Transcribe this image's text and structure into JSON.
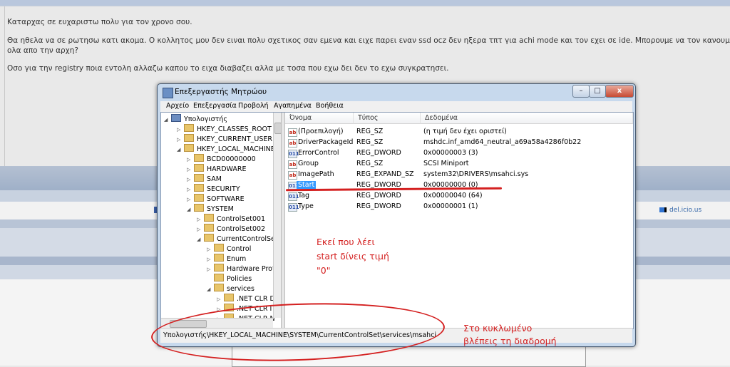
{
  "forum": {
    "line1": "Καταρχας σε ευχαριστω πολυ για τον χρονο σου.",
    "line2": "Θα ηθελα να σε ρωτησω κατι ακομα. Ο κολλητος μου δεν ειναι πολυ σχετικος σαν εμενα και ειχε παρει εναν ssd ocz δεν ηξερα τπτ για achi mode και τον εχει σε ide. Μπορουμε να τον κανουμε να δ",
    "line3": "ολα απο την αρχη?",
    "line4": "Οσο για την registry ποια εντολη αλλαζω καπου το ειχα διαβαζει αλλα με τοσα που εχω δει δεν το εχω συγκρατησει.",
    "delicious": "del.icio.us"
  },
  "window": {
    "title": "Επεξεργαστής Μητρώου",
    "menu": [
      "Αρχείο",
      "Επεξεργασία",
      "Προβολή",
      "Αγαπημένα",
      "Βοήθεια"
    ],
    "status_path": "Υπολογιστής\\HKEY_LOCAL_MACHINE\\SYSTEM\\CurrentControlSet\\services\\msahci"
  },
  "tree": [
    {
      "label": "Υπολογιστής",
      "icon": "computer-icon"
    },
    {
      "label": "HKEY_CLASSES_ROOT"
    },
    {
      "label": "HKEY_CURRENT_USER"
    },
    {
      "label": "HKEY_LOCAL_MACHINE"
    },
    {
      "label": "BCD00000000"
    },
    {
      "label": "HARDWARE"
    },
    {
      "label": "SAM"
    },
    {
      "label": "SECURITY"
    },
    {
      "label": "SOFTWARE"
    },
    {
      "label": "SYSTEM"
    },
    {
      "label": "ControlSet001"
    },
    {
      "label": "ControlSet002"
    },
    {
      "label": "CurrentControlSet"
    },
    {
      "label": "Control"
    },
    {
      "label": "Enum"
    },
    {
      "label": "Hardware Prof"
    },
    {
      "label": "Policies"
    },
    {
      "label": "services"
    },
    {
      "label": ".NET CLR D"
    },
    {
      "label": ".NET CLR I"
    },
    {
      "label": ".NET CLR N"
    }
  ],
  "columns": [
    "Όνομα",
    "Τύπος",
    "Δεδομένα"
  ],
  "values": [
    {
      "name": "(Προεπιλογή)",
      "type": "REG_SZ",
      "data": "(η τιμή δεν έχει οριστεί)",
      "icon": "ab"
    },
    {
      "name": "DriverPackageId",
      "type": "REG_SZ",
      "data": "mshdc.inf_amd64_neutral_a69a58a4286f0b22",
      "icon": "ab"
    },
    {
      "name": "ErrorControl",
      "type": "REG_DWORD",
      "data": "0x00000003 (3)",
      "icon": "bin"
    },
    {
      "name": "Group",
      "type": "REG_SZ",
      "data": "SCSI Miniport",
      "icon": "ab"
    },
    {
      "name": "ImagePath",
      "type": "REG_EXPAND_SZ",
      "data": "system32\\DRIVERS\\msahci.sys",
      "icon": "ab"
    },
    {
      "name": "Start",
      "type": "REG_DWORD",
      "data": "0x00000000 (0)",
      "icon": "bin",
      "selected": true
    },
    {
      "name": "Tag",
      "type": "REG_DWORD",
      "data": "0x00000040 (64)",
      "icon": "bin"
    },
    {
      "name": "Type",
      "type": "REG_DWORD",
      "data": "0x00000001 (1)",
      "icon": "bin"
    }
  ],
  "icon_text": {
    "ab": "ab",
    "bin": "011"
  },
  "annotations": {
    "note1_line1": "Εκεί που λέει",
    "note1_line2": "start δίνεις τιμή",
    "note1_line3": "\"0\"",
    "note2_line1": "Στο κυκλωμένο",
    "note2_line2": "βλέπεις τη διαδρομή",
    "color": "#d42020"
  },
  "window_buttons": {
    "min": "–",
    "max": "□",
    "close": "x"
  }
}
